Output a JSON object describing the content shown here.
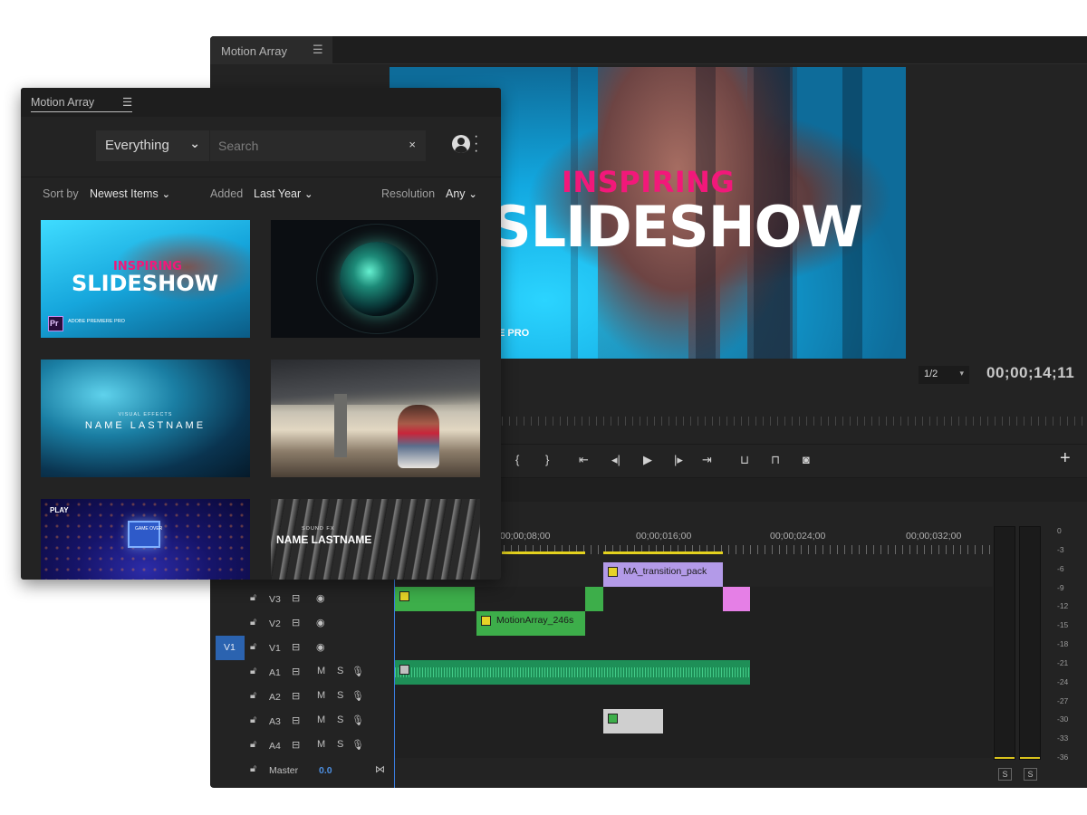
{
  "editor": {
    "tab_label": "Motion Array",
    "menu_glyph": "☰",
    "preview": {
      "title_top": "INSPIRING",
      "title_main": "SLIDESHOW",
      "caption": "E PRO"
    },
    "zoom_value": "1/2",
    "timecode": "00;00;14;11",
    "add_button": "+"
  },
  "timeline": {
    "ruler_labels": [
      "00;00;08;00",
      "00;00;016;00",
      "00;00;024;00",
      "00;00;032;00"
    ],
    "tracks": [
      {
        "name": "V3"
      },
      {
        "name": "V2"
      },
      {
        "name": "V1",
        "source": "V1"
      },
      {
        "name": "A1"
      },
      {
        "name": "A2"
      },
      {
        "name": "A3"
      },
      {
        "name": "A4"
      },
      {
        "name": "Master",
        "value": "0.0"
      }
    ],
    "audio_letters": {
      "mute": "M",
      "solo": "S"
    },
    "clips": {
      "transition": "MA_transition_pack",
      "motion": "MotionArray_246s"
    }
  },
  "meter": {
    "scale": [
      "0",
      "-3",
      "-6",
      "-9",
      "-12",
      "-15",
      "-18",
      "-21",
      "-24",
      "-27",
      "-30",
      "-33",
      "-36"
    ],
    "solo_buttons": [
      "S",
      "S"
    ]
  },
  "plugin": {
    "tab_label": "Motion Array",
    "menu_glyph": "☰",
    "category": "Everything",
    "search": {
      "placeholder": "Search",
      "value": ""
    },
    "clear_glyph": "×",
    "filters": {
      "sort_label": "Sort by",
      "sort_value": "Newest Items",
      "added_label": "Added",
      "added_value": "Last Year",
      "resolution_label": "Resolution",
      "resolution_value": "Any"
    },
    "thumbnails": {
      "slideshow_top": "INSPIRING",
      "slideshow_main": "SLIDESHOW",
      "slideshow_badge": "Pr",
      "slideshow_badge_sub": "ADOBE PREMIERE PRO",
      "vfx_sub": "VISUAL EFFECTS",
      "vfx_name": "NAME LASTNAME",
      "play_label": "PLAY",
      "game_over": "GAME OVER",
      "sfx_sub": "SOUND FX",
      "sfx_name": "NAME LASTNAME"
    }
  }
}
